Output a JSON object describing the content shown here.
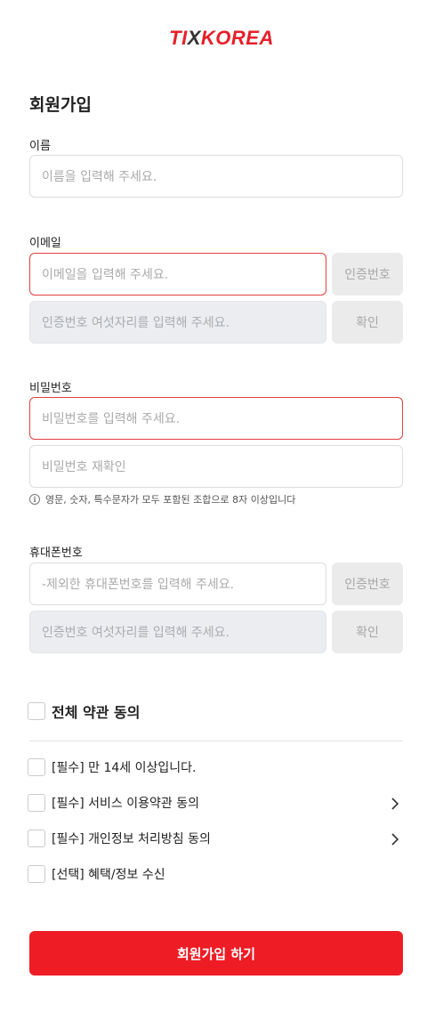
{
  "logo": {
    "text_a": "TI",
    "text_x": "X",
    "text_b": "KOREA"
  },
  "title": "회원가입",
  "name": {
    "label": "이름",
    "placeholder": "이름을 입력해 주세요."
  },
  "email": {
    "label": "이메일",
    "placeholder": "이메일을 입력해 주세요.",
    "verify_button": "인증번호",
    "code_placeholder": "인증번호 여섯자리를 입력해 주세요.",
    "confirm_button": "확인"
  },
  "password": {
    "label": "비밀번호",
    "placeholder": "비밀번호를 입력해 주세요.",
    "confirm_placeholder": "비밀번호 재확인",
    "hint": "영문, 숫자, 특수문자가 모두 포함된 조합으로 8자 이상입니다"
  },
  "phone": {
    "label": "휴대폰번호",
    "placeholder": "-제외한 휴대폰번호를 입력해 주세요.",
    "verify_button": "인증번호",
    "code_placeholder": "인증번호 여섯자리를 입력해 주세요.",
    "confirm_button": "확인"
  },
  "agreements": {
    "all": "전체 약관 동의",
    "items": [
      {
        "label": "[필수] 만 14세 이상입니다.",
        "has_arrow": false
      },
      {
        "label": "[필수] 서비스 이용약관 동의",
        "has_arrow": true
      },
      {
        "label": "[필수] 개인정보 처리방침 동의",
        "has_arrow": true
      },
      {
        "label": "[선택] 혜택/정보 수신",
        "has_arrow": false
      }
    ]
  },
  "submit_label": "회원가입 하기",
  "colors": {
    "brand": "#ee1c25",
    "error_border": "#e04040"
  }
}
